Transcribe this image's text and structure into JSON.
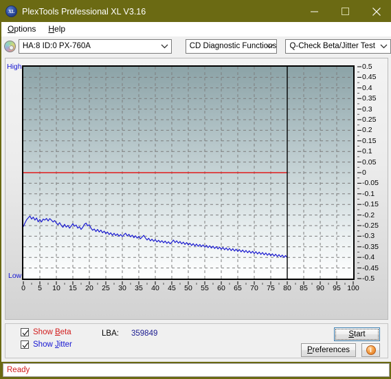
{
  "window": {
    "title": "PlexTools Professional XL V3.16",
    "app_icon_text": "XL",
    "minimize": "minimize-icon",
    "maximize": "maximize-icon",
    "close": "close-icon",
    "titlebar_color": "#6b6a13"
  },
  "menubar": {
    "items": [
      {
        "label": "Options",
        "accel": "O"
      },
      {
        "label": "Help",
        "accel": "H"
      }
    ]
  },
  "toolbar": {
    "drive_icon": "cd-disc-icon",
    "drive_select": "HA:8 ID:0  PX-760A",
    "function_select": "CD Diagnostic Functions",
    "test_select": "Q-Check Beta/Jitter Test"
  },
  "chart_panel": {
    "high_label": "High",
    "low_label": "Low"
  },
  "controls": {
    "show_beta": {
      "label": "Show Beta",
      "accel": "B",
      "checked": true,
      "color": "#d11b1b"
    },
    "show_jitter": {
      "label": "Show Jitter",
      "accel": "J",
      "checked": true,
      "color": "#1414d2"
    },
    "lba_label": "LBA:",
    "lba_value": "359849",
    "start_button": {
      "label": "Start",
      "accel": "S"
    },
    "preferences_button": {
      "label": "Preferences",
      "accel": "P"
    },
    "info_button": {
      "label": "i",
      "name": "info-icon"
    }
  },
  "statusbar": {
    "text": "Ready"
  },
  "chart_data": {
    "type": "line",
    "title": "Q-Check Beta/Jitter Test",
    "xlabel": "",
    "ylabel": "",
    "xlim": [
      0,
      100
    ],
    "ylim": [
      -0.5,
      0.5
    ],
    "grid": true,
    "legend": "none",
    "x_ticks": [
      0,
      5,
      10,
      15,
      20,
      25,
      30,
      35,
      40,
      45,
      50,
      55,
      60,
      65,
      70,
      75,
      80,
      85,
      90,
      95,
      100
    ],
    "y_ticks": [
      0.5,
      0.45,
      0.4,
      0.35,
      0.3,
      0.25,
      0.2,
      0.15,
      0.1,
      0.05,
      0,
      -0.05,
      -0.1,
      -0.15,
      -0.2,
      -0.25,
      -0.3,
      -0.35,
      -0.4,
      -0.45,
      -0.5
    ],
    "axis_annotations": {
      "top": "High",
      "bottom": "Low"
    },
    "cursor_line_x": 80,
    "data_end_x": 80,
    "series": [
      {
        "name": "Beta",
        "color": "#e01b1b",
        "constant_value": 0,
        "x": [
          0,
          80
        ],
        "values": [
          0,
          0
        ]
      },
      {
        "name": "Jitter",
        "color": "#1a1ad0",
        "x": [
          0.0,
          0.5,
          1.0,
          1.5,
          2.0,
          2.5,
          3.0,
          3.5,
          4.0,
          4.5,
          5.0,
          5.5,
          6.0,
          6.5,
          7.0,
          7.5,
          8.0,
          8.5,
          9.0,
          9.5,
          10.0,
          10.5,
          11.0,
          11.5,
          12.0,
          12.5,
          13.0,
          13.5,
          14.0,
          14.5,
          15.0,
          15.5,
          16.0,
          16.5,
          17.0,
          17.5,
          18.0,
          18.5,
          19.0,
          19.5,
          20.0,
          20.5,
          21.0,
          21.5,
          22.0,
          22.5,
          23.0,
          23.5,
          24.0,
          24.5,
          25.0,
          25.5,
          26.0,
          26.5,
          27.0,
          27.5,
          28.0,
          28.5,
          29.0,
          29.5,
          30.0,
          30.5,
          31.0,
          31.5,
          32.0,
          32.5,
          33.0,
          33.5,
          34.0,
          34.5,
          35.0,
          35.5,
          36.0,
          36.5,
          37.0,
          37.5,
          38.0,
          38.5,
          39.0,
          39.5,
          40.0,
          40.5,
          41.0,
          41.5,
          42.0,
          42.5,
          43.0,
          43.5,
          44.0,
          44.5,
          45.0,
          45.5,
          46.0,
          46.5,
          47.0,
          47.5,
          48.0,
          48.5,
          49.0,
          49.5,
          50.0,
          50.5,
          51.0,
          51.5,
          52.0,
          52.5,
          53.0,
          53.5,
          54.0,
          54.5,
          55.0,
          55.5,
          56.0,
          56.5,
          57.0,
          57.5,
          58.0,
          58.5,
          59.0,
          59.5,
          60.0,
          60.5,
          61.0,
          61.5,
          62.0,
          62.5,
          63.0,
          63.5,
          64.0,
          64.5,
          65.0,
          65.5,
          66.0,
          66.5,
          67.0,
          67.5,
          68.0,
          68.5,
          69.0,
          69.5,
          70.0,
          70.5,
          71.0,
          71.5,
          72.0,
          72.5,
          73.0,
          73.5,
          74.0,
          74.5,
          75.0,
          75.5,
          76.0,
          76.5,
          77.0,
          77.5,
          78.0,
          78.5,
          79.0,
          79.5,
          80.0
        ],
        "values": [
          -0.255,
          -0.237,
          -0.222,
          -0.213,
          -0.205,
          -0.219,
          -0.21,
          -0.224,
          -0.214,
          -0.232,
          -0.221,
          -0.233,
          -0.219,
          -0.224,
          -0.216,
          -0.228,
          -0.217,
          -0.224,
          -0.233,
          -0.226,
          -0.238,
          -0.246,
          -0.236,
          -0.249,
          -0.258,
          -0.244,
          -0.257,
          -0.249,
          -0.262,
          -0.252,
          -0.241,
          -0.253,
          -0.247,
          -0.262,
          -0.255,
          -0.268,
          -0.258,
          -0.244,
          -0.238,
          -0.251,
          -0.246,
          -0.262,
          -0.272,
          -0.266,
          -0.278,
          -0.268,
          -0.28,
          -0.271,
          -0.284,
          -0.276,
          -0.288,
          -0.28,
          -0.292,
          -0.284,
          -0.296,
          -0.286,
          -0.297,
          -0.289,
          -0.3,
          -0.292,
          -0.302,
          -0.293,
          -0.286,
          -0.299,
          -0.291,
          -0.303,
          -0.295,
          -0.307,
          -0.298,
          -0.309,
          -0.301,
          -0.312,
          -0.304,
          -0.296,
          -0.308,
          -0.318,
          -0.31,
          -0.322,
          -0.314,
          -0.324,
          -0.316,
          -0.327,
          -0.319,
          -0.329,
          -0.321,
          -0.331,
          -0.323,
          -0.334,
          -0.326,
          -0.336,
          -0.328,
          -0.318,
          -0.33,
          -0.322,
          -0.333,
          -0.325,
          -0.336,
          -0.328,
          -0.339,
          -0.33,
          -0.341,
          -0.333,
          -0.344,
          -0.335,
          -0.346,
          -0.337,
          -0.348,
          -0.339,
          -0.349,
          -0.341,
          -0.352,
          -0.343,
          -0.354,
          -0.345,
          -0.356,
          -0.347,
          -0.358,
          -0.349,
          -0.36,
          -0.351,
          -0.362,
          -0.353,
          -0.364,
          -0.355,
          -0.366,
          -0.357,
          -0.368,
          -0.359,
          -0.37,
          -0.361,
          -0.372,
          -0.363,
          -0.374,
          -0.365,
          -0.376,
          -0.367,
          -0.378,
          -0.369,
          -0.38,
          -0.371,
          -0.382,
          -0.373,
          -0.384,
          -0.375,
          -0.386,
          -0.377,
          -0.388,
          -0.379,
          -0.39,
          -0.381,
          -0.392,
          -0.383,
          -0.394,
          -0.385,
          -0.396,
          -0.387,
          -0.398,
          -0.389,
          -0.4,
          -0.391,
          -0.402,
          -0.393,
          -0.405
        ]
      }
    ]
  }
}
